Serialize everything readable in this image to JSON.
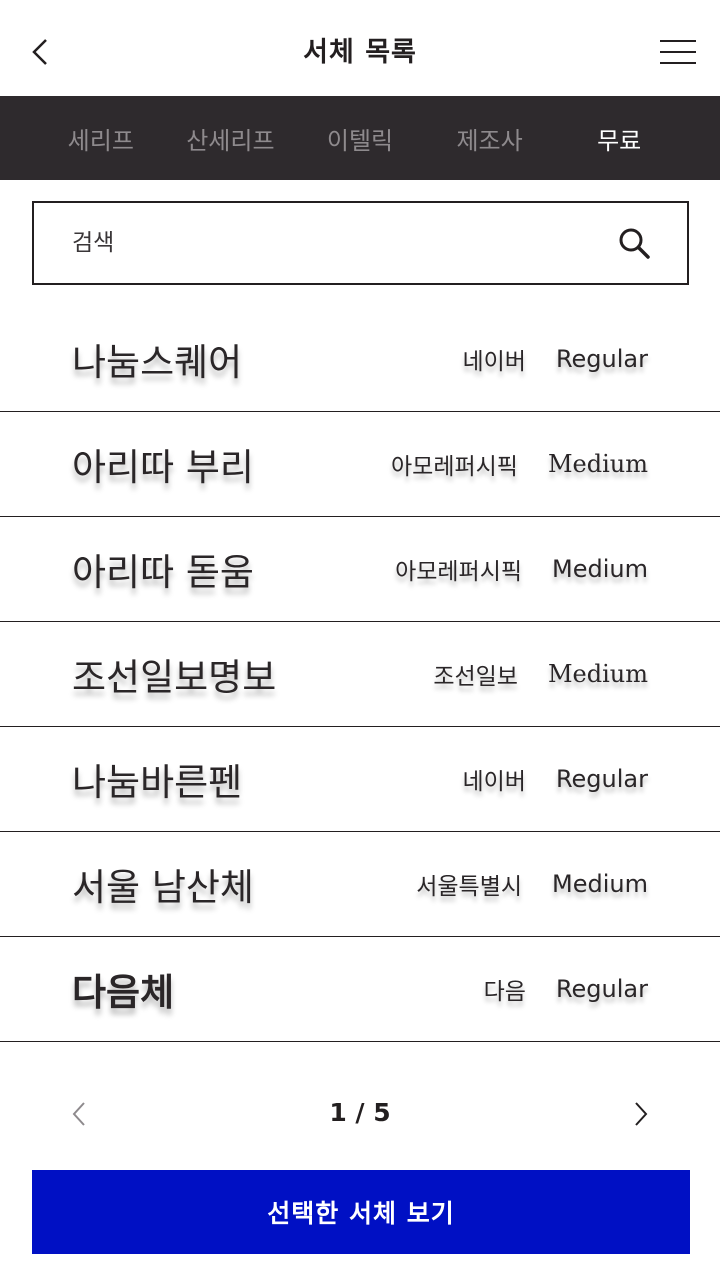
{
  "header": {
    "title": "서체 목록"
  },
  "tabs": [
    {
      "label": "세리프",
      "active": false
    },
    {
      "label": "산세리프",
      "active": false
    },
    {
      "label": "이텔릭",
      "active": false
    },
    {
      "label": "제조사",
      "active": false
    },
    {
      "label": "무료",
      "active": true
    }
  ],
  "search": {
    "placeholder": "검색",
    "value": ""
  },
  "fonts": [
    {
      "name": "나눔스퀘어",
      "vendor": "네이버",
      "weight": "Regular"
    },
    {
      "name": "아리따 부리",
      "vendor": "아모레퍼시픽",
      "weight": "Medium"
    },
    {
      "name": "아리따 돋움",
      "vendor": "아모레퍼시픽",
      "weight": "Medium"
    },
    {
      "name": "조선일보명보",
      "vendor": "조선일보",
      "weight": "Medium"
    },
    {
      "name": "나눔바른펜",
      "vendor": "네이버",
      "weight": "Regular"
    },
    {
      "name": "서울 남산체",
      "vendor": "서울특별시",
      "weight": "Medium"
    },
    {
      "name": "다음체",
      "vendor": "다음",
      "weight": "Regular"
    }
  ],
  "pager": {
    "text": "1 / 5"
  },
  "cta": {
    "label": "선택한 서체 보기"
  },
  "colors": {
    "tab_bar": "#2e2a2d",
    "cta": "#0010c4",
    "text": "#231f20"
  }
}
